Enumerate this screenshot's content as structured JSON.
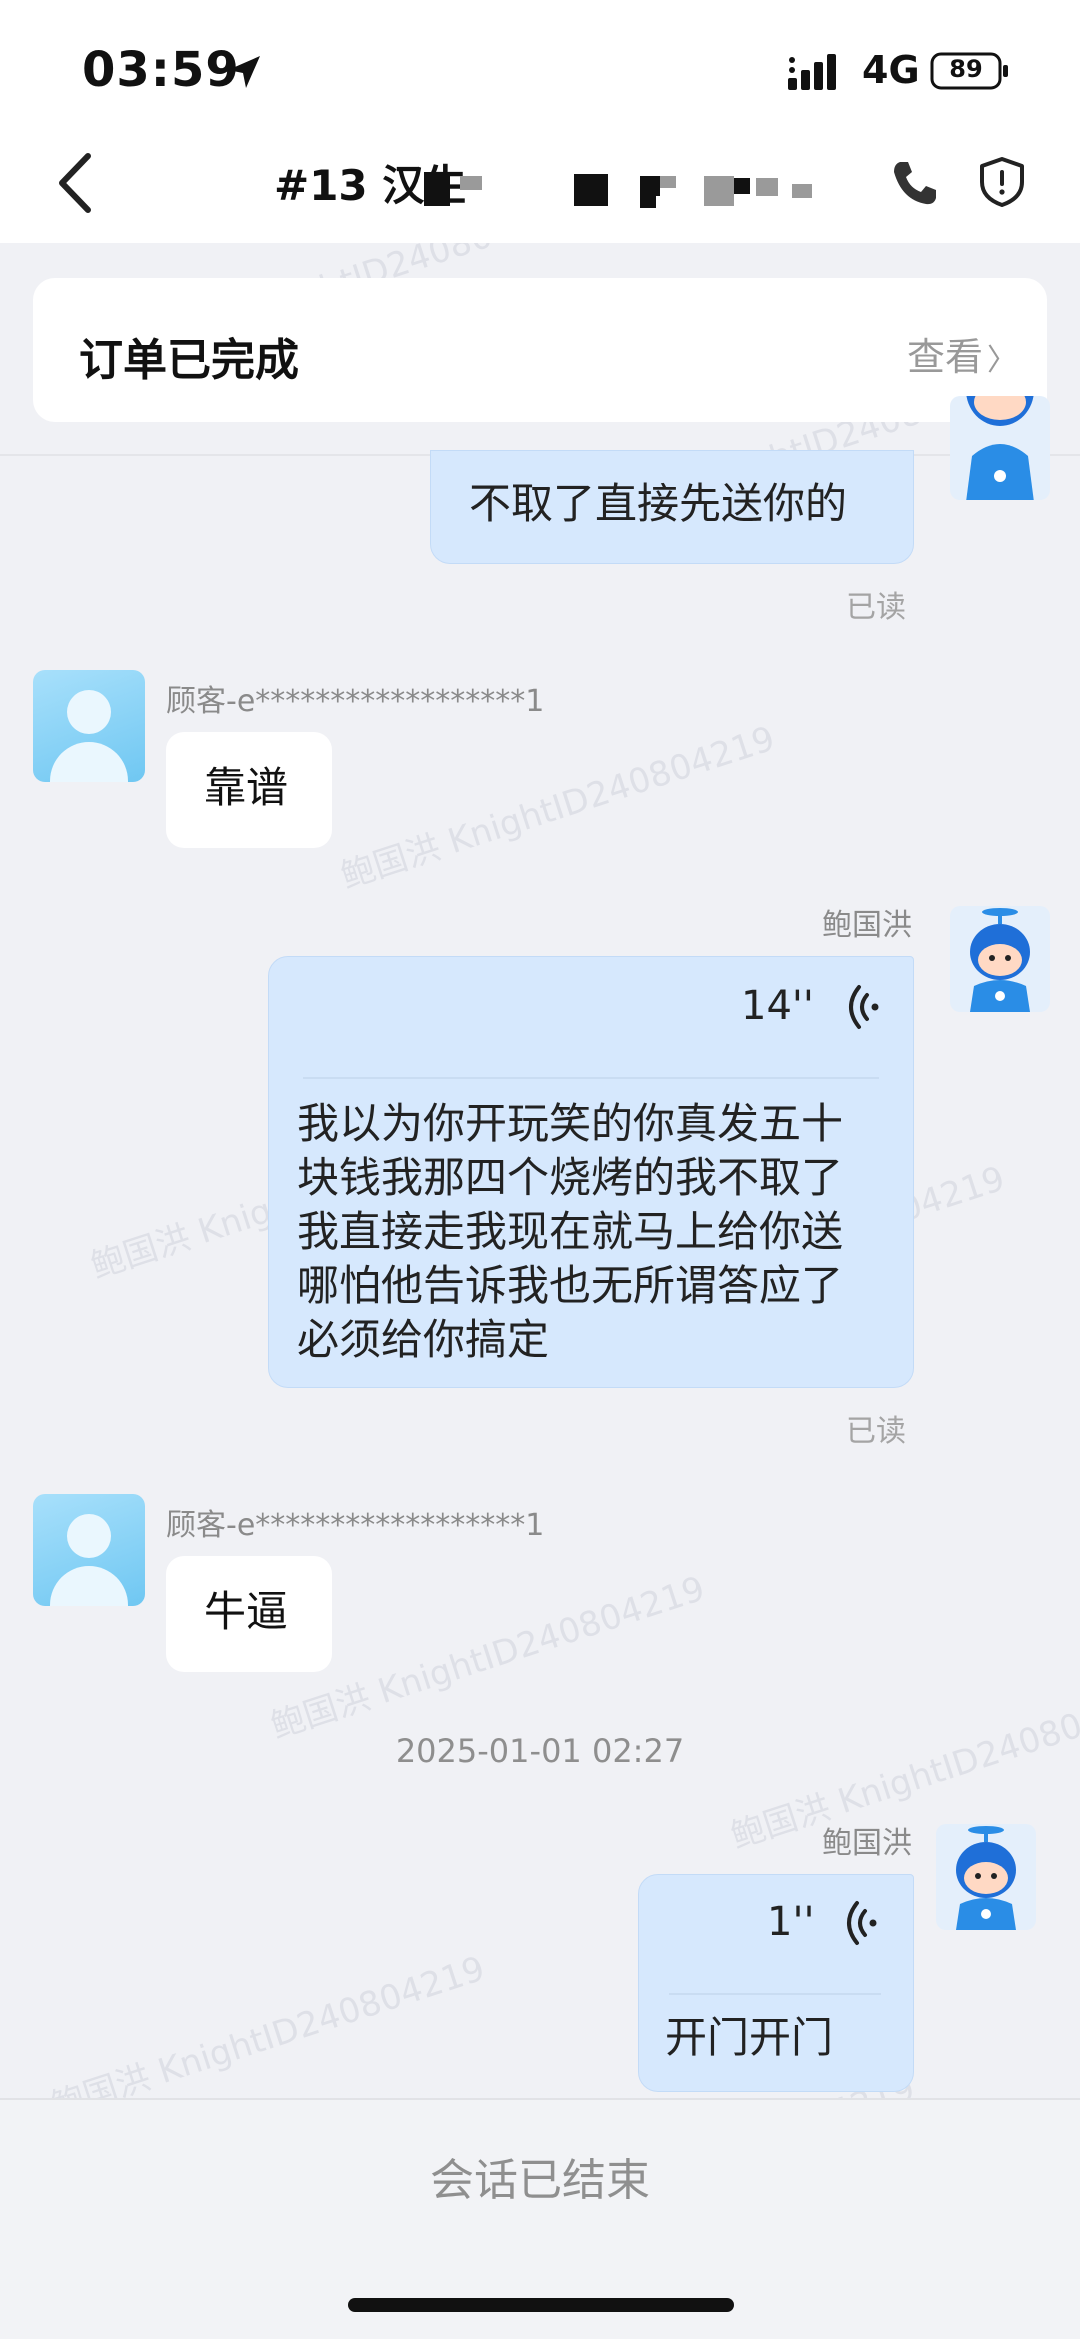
{
  "status_bar": {
    "time": "03:59",
    "network": "4G",
    "battery": "89"
  },
  "header": {
    "title": "#13 汉生"
  },
  "order_card": {
    "status": "订单已完成",
    "view_label": "查看",
    "view_chevron": "〉"
  },
  "messages": {
    "m1": {
      "text": "不取了直接先送你的",
      "status": "已读"
    },
    "m2": {
      "sender": "顾客-e******************1",
      "text": "靠谱"
    },
    "m3": {
      "sender": "鲍国洪",
      "duration": "14''",
      "lines": [
        "我以为你开玩笑的你真发五十",
        "块钱我那四个烧烤的我不取了",
        "我直接走我现在就马上给你送",
        "哪怕他告诉我也无所谓答应了",
        "必须给你搞定"
      ],
      "status": "已读"
    },
    "m4": {
      "sender": "顾客-e******************1",
      "text": "牛逼"
    },
    "timestamp": "2025-01-01 02:27",
    "m5": {
      "sender": "鲍国洪",
      "duration": "1''",
      "text": "开门开门"
    }
  },
  "footer": {
    "text": "会话已结束"
  },
  "watermark": "鲍国洪 KnightID240804219",
  "colors": {
    "bubble_out": "#d6e8fd",
    "background": "#f0f1f5",
    "accent_avatar": "#6fc7f2"
  },
  "icons": [
    "location-arrow-icon",
    "signal-bars-icon",
    "battery-icon",
    "back-chevron-icon",
    "phone-icon",
    "shield-alert-icon",
    "voice-wave-icon"
  ]
}
